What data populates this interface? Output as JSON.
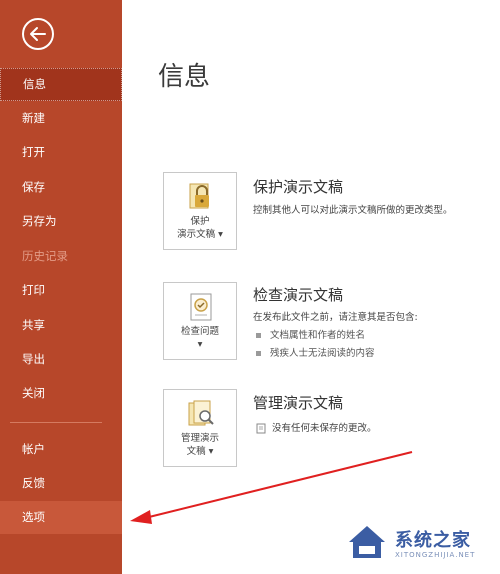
{
  "sidebar": {
    "items": [
      {
        "label": "信息"
      },
      {
        "label": "新建"
      },
      {
        "label": "打开"
      },
      {
        "label": "保存"
      },
      {
        "label": "另存为"
      },
      {
        "label": "历史记录"
      },
      {
        "label": "打印"
      },
      {
        "label": "共享"
      },
      {
        "label": "导出"
      },
      {
        "label": "关闭"
      },
      {
        "label": "帐户"
      },
      {
        "label": "反馈"
      },
      {
        "label": "选项"
      }
    ],
    "colors": {
      "background": "#b7472a",
      "active": "#a1341c",
      "hover": "#c8583a",
      "disabled_text": "#e39b87"
    }
  },
  "main": {
    "title": "信息",
    "sections": [
      {
        "button_label_1": "保护",
        "button_label_2": "演示文稿",
        "title": "保护演示文稿",
        "description": "控制其他人可以对此演示文稿所做的更改类型。"
      },
      {
        "button_label_1": "检查问题",
        "title": "检查演示文稿",
        "description": "在发布此文件之前，请注意其是否包含:",
        "bullets": [
          "文档属性和作者的姓名",
          "残疾人士无法阅读的内容"
        ]
      },
      {
        "button_label_1": "管理演示",
        "button_label_2": "文稿",
        "title": "管理演示文稿",
        "description": "没有任何未保存的更改。"
      }
    ]
  },
  "watermark": {
    "main": "系统之家",
    "sub": "XITONGZHIJIA.NET"
  },
  "annotation": {
    "arrow_color": "#e02020"
  }
}
